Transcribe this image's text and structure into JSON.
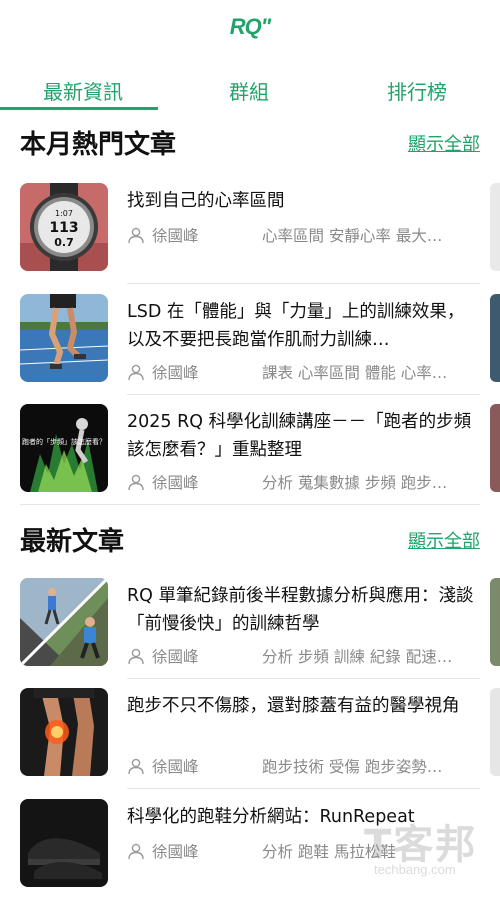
{
  "app": {
    "logo": "RQ\""
  },
  "tabs": [
    {
      "label": "最新資訊",
      "active": true
    },
    {
      "label": "群組",
      "active": false
    },
    {
      "label": "排行榜",
      "active": false
    }
  ],
  "sections": [
    {
      "title": "本月熱門文章",
      "link": "顯示全部",
      "articles": [
        {
          "title": "找到自己的心率區間",
          "author": "徐國峰",
          "tags": "心率區間 安靜心率 最大…",
          "thumb": "watch-image"
        },
        {
          "title": "LSD 在「體能」與「力量」上的訓練效果，以及不要把長跑當作肌耐力訓練…",
          "author": "徐國峰",
          "tags": "課表 心率區間 體能 心率…",
          "thumb": "runner-track-image"
        },
        {
          "title": "2025 RQ 科學化訓練講座－－「跑者的步頻該怎麼看？」重點整理",
          "author": "徐國峰",
          "tags": "分析 蒐集數據 步頻 跑步…",
          "thumb": "cadence-lecture-image",
          "thumb_caption": "跑者的「步頻」該怎麼看？"
        }
      ]
    },
    {
      "title": "最新文章",
      "link": "顯示全部",
      "articles": [
        {
          "title": "RQ 單筆紀錄前後半程數據分析與應用：淺談「前慢後快」的訓練哲學",
          "author": "徐國峰",
          "tags": "分析 步頻 訓練 紀錄 配速…",
          "thumb": "runners-split-image"
        },
        {
          "title": "跑步不只不傷膝，還對膝蓋有益的醫學視角",
          "author": "徐國峰",
          "tags": "跑步技術 受傷 跑步姿勢…",
          "thumb": "knee-image"
        },
        {
          "title": "科學化的跑鞋分析網站：RunRepeat",
          "author": "徐國峰",
          "tags": "分析 跑鞋 馬拉松鞋",
          "thumb": "shoe-image"
        }
      ]
    }
  ],
  "watermark": {
    "text": "T客邦",
    "sub": "techbang.com"
  },
  "colors": {
    "accent": "#21a36b"
  }
}
